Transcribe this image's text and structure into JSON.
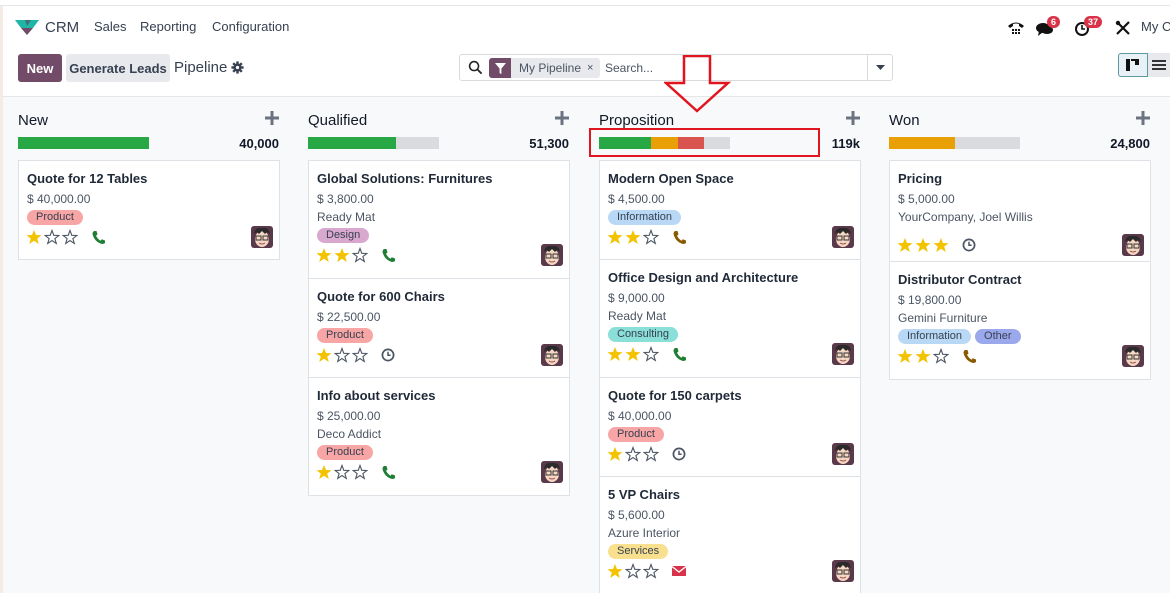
{
  "navbar": {
    "app_name": "CRM",
    "menu": [
      "Sales",
      "Reporting",
      "Configuration"
    ],
    "systray": {
      "phone_icon": "phone-icon",
      "messages_badge": "6",
      "activities_badge": "37",
      "tools_icon": "debug-tools-icon",
      "company": "My Company"
    }
  },
  "control_panel": {
    "new_label": "New",
    "generate_leads_label": "Generate Leads",
    "breadcrumb": "Pipeline",
    "search": {
      "facet_label": "My Pipeline",
      "facet_close": "×",
      "placeholder": "Search...",
      "value": ""
    },
    "views": [
      "kanban",
      "list"
    ],
    "active_view": "kanban"
  },
  "colors": {
    "brand": "#714b67",
    "progress_won": "#28a745",
    "progress_planned": "#e9a006",
    "progress_overdue": "#d9534f",
    "progress_empty": "#d9dbde",
    "annotation": "#e0151f"
  },
  "columns": [
    {
      "title": "New",
      "total": "40,000",
      "progress": [
        {
          "status": "planned-ok",
          "fraction": 1.0,
          "color": "#28a745"
        }
      ],
      "cards": [
        {
          "title": "Quote for 12 Tables",
          "amount": "$ 40,000.00",
          "partner": "",
          "tags": [
            {
              "label": "Product",
              "color": "#f7a5a5"
            }
          ],
          "stars": 1,
          "activity": "phone",
          "activity_color": "#1e7e34"
        }
      ]
    },
    {
      "title": "Qualified",
      "total": "51,300",
      "progress": [
        {
          "status": "planned-ok",
          "fraction": 0.67,
          "color": "#28a745"
        }
      ],
      "cards": [
        {
          "title": "Global Solutions: Furnitures",
          "amount": "$ 3,800.00",
          "partner": "Ready Mat",
          "tags": [
            {
              "label": "Design",
              "color": "#d9a8cf"
            }
          ],
          "stars": 2,
          "activity": "phone",
          "activity_color": "#1e7e34"
        },
        {
          "title": "Quote for 600 Chairs",
          "amount": "$ 22,500.00",
          "partner": "",
          "tags": [
            {
              "label": "Product",
              "color": "#f7a5a5"
            }
          ],
          "stars": 1,
          "activity": "clock",
          "activity_color": "#4b5563"
        },
        {
          "title": "Info about services",
          "amount": "$ 25,000.00",
          "partner": "Deco Addict",
          "tags": [
            {
              "label": "Product",
              "color": "#f7a5a5"
            }
          ],
          "stars": 1,
          "activity": "phone",
          "activity_color": "#1e7e34"
        }
      ]
    },
    {
      "title": "Proposition",
      "total": "119k",
      "progress": [
        {
          "status": "planned-ok",
          "fraction": 0.4,
          "color": "#28a745"
        },
        {
          "status": "today",
          "fraction": 0.2,
          "color": "#e9a006"
        },
        {
          "status": "overdue",
          "fraction": 0.2,
          "color": "#d9534f"
        }
      ],
      "cards": [
        {
          "title": "Modern Open Space",
          "amount": "$ 4,500.00",
          "partner": "",
          "tags": [
            {
              "label": "Information",
              "color": "#b8d8f5"
            }
          ],
          "stars": 2,
          "activity": "phone",
          "activity_color": "#8a5a00"
        },
        {
          "title": "Office Design and Architecture",
          "amount": "$ 9,000.00",
          "partner": "Ready Mat",
          "tags": [
            {
              "label": "Consulting",
              "color": "#8ae0d8"
            }
          ],
          "stars": 2,
          "activity": "phone",
          "activity_color": "#1e7e34"
        },
        {
          "title": "Quote for 150 carpets",
          "amount": "$ 40,000.00",
          "partner": "",
          "tags": [
            {
              "label": "Product",
              "color": "#f7a5a5"
            }
          ],
          "stars": 1,
          "activity": "clock",
          "activity_color": "#4b5563"
        },
        {
          "title": "5 VP Chairs",
          "amount": "$ 5,600.00",
          "partner": "Azure Interior",
          "tags": [
            {
              "label": "Services",
              "color": "#f8e08e"
            }
          ],
          "stars": 1,
          "activity": "envelope",
          "activity_color": "#d9334a"
        }
      ]
    },
    {
      "title": "Won",
      "total": "24,800",
      "progress": [
        {
          "status": "today",
          "fraction": 0.5,
          "color": "#e9a006"
        }
      ],
      "cards": [
        {
          "title": "Pricing",
          "amount": "$ 5,000.00",
          "partner": "YourCompany, Joel Willis",
          "tags": [],
          "stars": 3,
          "activity": "clock",
          "activity_color": "#4b5563"
        },
        {
          "title": "Distributor Contract",
          "amount": "$ 19,800.00",
          "partner": "Gemini Furniture",
          "tags": [
            {
              "label": "Information",
              "color": "#b8d8f5"
            },
            {
              "label": "Other",
              "color": "#9ba8ec"
            }
          ],
          "stars": 2,
          "activity": "phone",
          "activity_color": "#8a5a00"
        }
      ]
    }
  ],
  "annotations": {
    "arrow": "down-arrow-annotation",
    "highlight": "proposition-progress-highlight"
  }
}
